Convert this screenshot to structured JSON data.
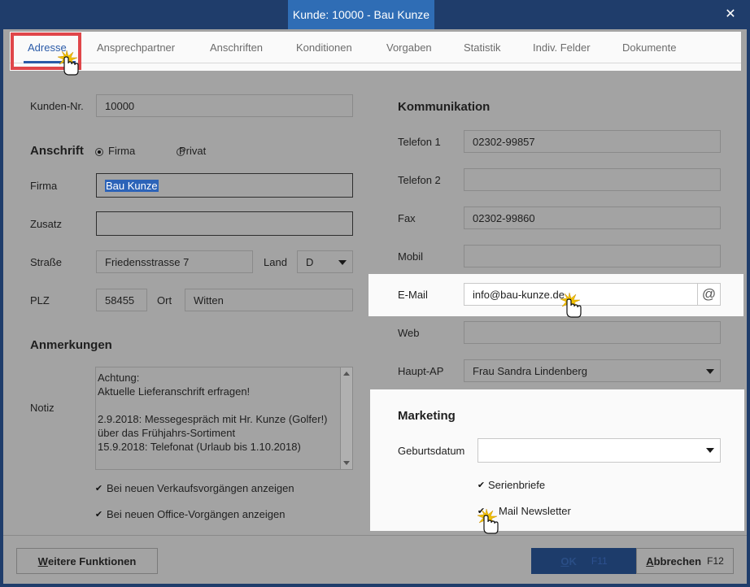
{
  "window": {
    "title": "Kunde: 10000 - Bau Kunze",
    "close_glyph": "✕"
  },
  "tabs": [
    {
      "label": "Adresse",
      "active": true
    },
    {
      "label": "Ansprechpartner"
    },
    {
      "label": "Anschriften"
    },
    {
      "label": "Konditionen"
    },
    {
      "label": "Vorgaben"
    },
    {
      "label": "Statistik"
    },
    {
      "label": "Indiv. Felder"
    },
    {
      "label": "Dokumente"
    }
  ],
  "left": {
    "kundennr_label": "Kunden-Nr.",
    "kundennr_value": "10000",
    "anschrift_title": "Anschrift",
    "radio_firma": "Firma",
    "radio_privat": "Privat",
    "firma_label": "Firma",
    "firma_value": "Bau Kunze",
    "zusatz_label": "Zusatz",
    "zusatz_value": "",
    "strasse_label": "Straße",
    "strasse_value": "Friedensstrasse 7",
    "land_label": "Land",
    "land_value": "D",
    "plz_label": "PLZ",
    "plz_value": "58455",
    "ort_label": "Ort",
    "ort_value": "Witten",
    "anmerkungen_title": "Anmerkungen",
    "notiz_label": "Notiz",
    "notiz_text": "Achtung:\nAktuelle Lieferanschrift erfragen!\n\n2.9.2018: Messegespräch mit Hr. Kunze (Golfer!)\nüber das Frühjahrs-Sortiment\n15.9.2018: Telefonat (Urlaub bis 1.10.2018)",
    "chk_verkauf": "Bei neuen Verkaufsvorgängen anzeigen",
    "chk_office": "Bei neuen Office-Vorgängen anzeigen"
  },
  "right": {
    "kommunikation_title": "Kommunikation",
    "telefon1_label": "Telefon 1",
    "telefon1_value": "02302-99857",
    "telefon2_label": "Telefon 2",
    "telefon2_value": "",
    "fax_label": "Fax",
    "fax_value": "02302-99860",
    "mobil_label": "Mobil",
    "mobil_value": "",
    "email_label": "E-Mail",
    "email_value": "info@bau-kunze.de",
    "email_button_glyph": "@",
    "web_label": "Web",
    "web_value": "",
    "hauptap_label": "Haupt-AP",
    "hauptap_value": "Frau Sandra Lindenberg",
    "marketing_title": "Marketing",
    "geburtsdatum_label": "Geburtsdatum",
    "geburtsdatum_value": "",
    "chk_serienbriefe": "Serienbriefe",
    "chk_newsletter": "Mail Newsletter"
  },
  "buttons": {
    "weitere_first": "W",
    "weitere_rest": "eitere Funktionen",
    "ok_first": "O",
    "ok_rest": "K",
    "ok_key": "F11",
    "abbrechen_first": "A",
    "abbrechen_rest": "bbrechen",
    "abbrechen_key": "F12"
  },
  "icons": {
    "check": "✔"
  }
}
